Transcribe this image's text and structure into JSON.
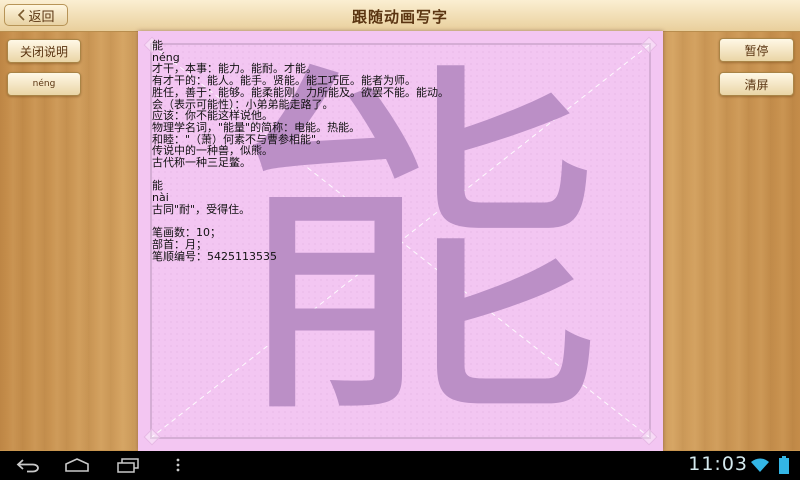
{
  "header": {
    "back_label": "返回",
    "title": "跟随动画写字"
  },
  "left_buttons": {
    "close_description": "关闭说明",
    "pinyin": "néng"
  },
  "right_buttons": {
    "pause": "暂停",
    "clear_screen": "清屏"
  },
  "character": "能",
  "description_lines": [
    "能",
    "néng",
    "才干，本事：能力。能耐。才能。",
    "有才干的：能人。能手。贤能。能工巧匠。能者为师。",
    "胜任，善于：能够。能柔能刚。力所能及。欲罢不能。能动。",
    "会（表示可能性）：小弟弟能走路了。",
    "应该：你不能这样说他。",
    "物理学名词，\"能量\"的简称：电能。热能。",
    "和睦：\"（萧）何素不与曹参相能\"。",
    "传说中的一种兽，似熊。",
    "古代称一种三足鳖。",
    "",
    "能",
    "nài",
    "古同\"耐\"，受得住。",
    "",
    "笔画数：10；",
    "部首：月；",
    "笔顺编号：5425113535"
  ],
  "status_bar": {
    "time": "11:03"
  },
  "icons": {
    "back": "back-icon",
    "home": "home-icon",
    "recent": "recent-apps-icon",
    "menu": "menu-icon",
    "wifi": "wifi-icon",
    "battery": "battery-icon"
  }
}
